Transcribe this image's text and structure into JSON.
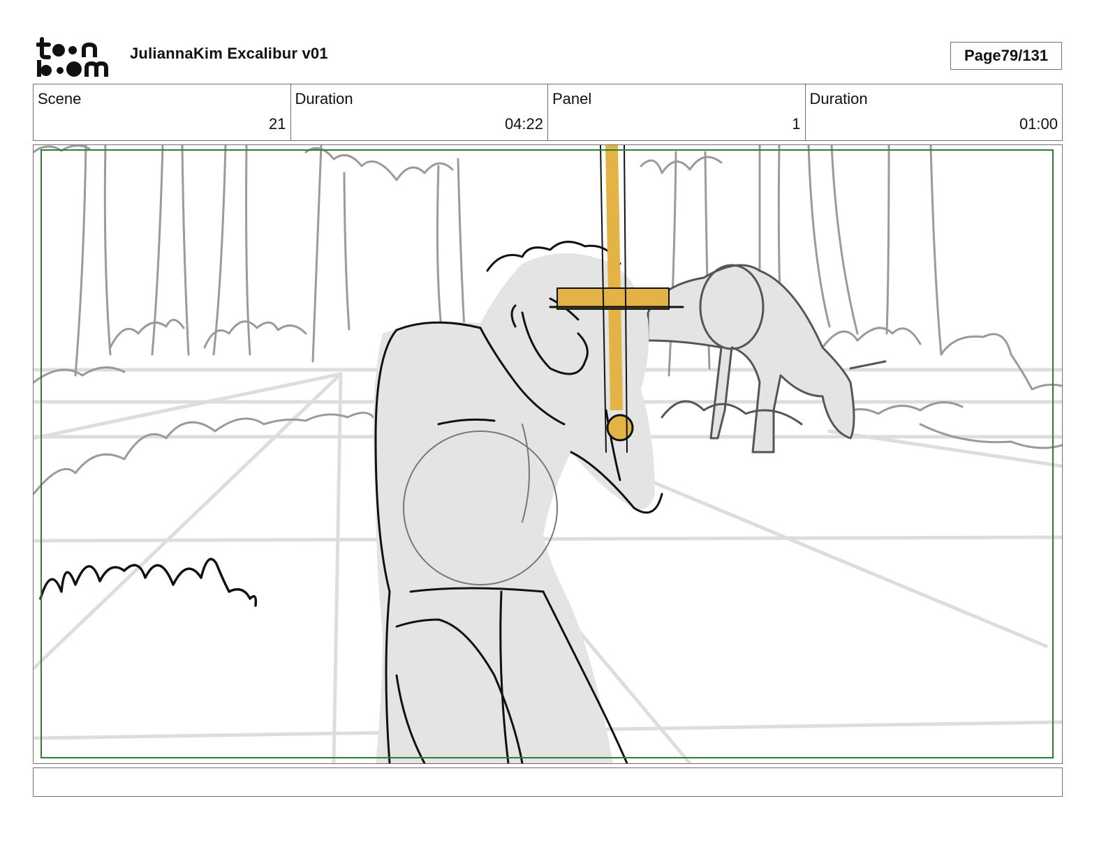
{
  "header": {
    "brand_top": "toon",
    "brand_bottom": "boom",
    "title": "JuliannaKim Excalibur v01",
    "page_label": "Page",
    "page_value": "79/131"
  },
  "info": {
    "scene_label": "Scene",
    "scene_value": "21",
    "scene_duration_label": "Duration",
    "scene_duration_value": "04:22",
    "panel_label": "Panel",
    "panel_value": "1",
    "panel_duration_label": "Duration",
    "panel_duration_value": "01:00"
  },
  "notes": {
    "text": ""
  },
  "colors": {
    "frame_border": "#6f6f6f",
    "safe_area_green": "#2e7d32",
    "sword_gold": "#e3b445",
    "figure_fill": "#e4e4e4",
    "sketch_gray": "#9a9a9a"
  },
  "icons": {
    "logo": "toonboom-logo",
    "panel_sketch": "storyboard-panel-drawing"
  }
}
